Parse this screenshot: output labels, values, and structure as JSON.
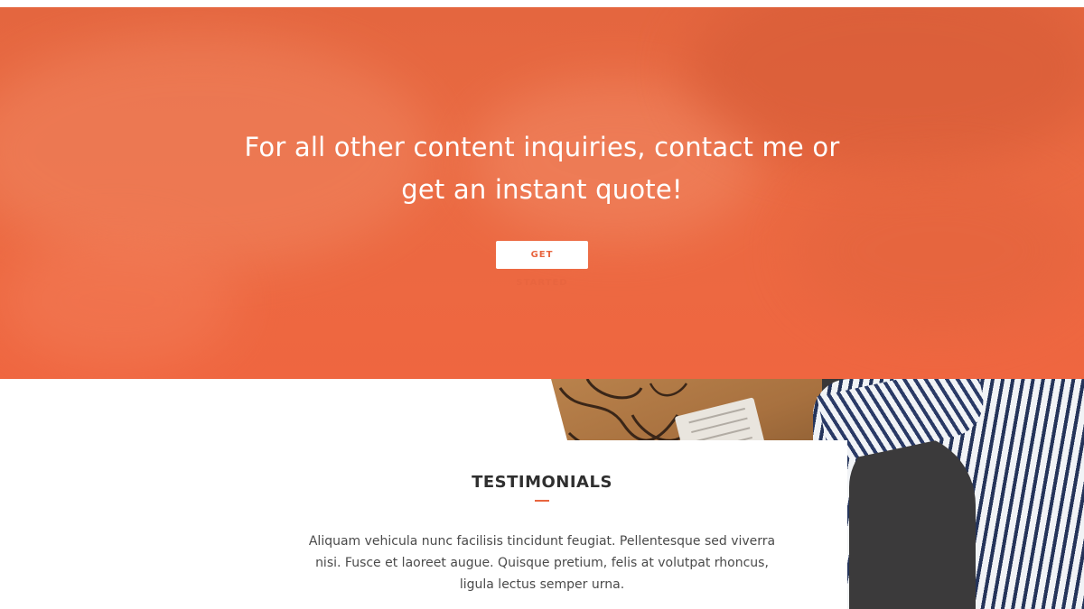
{
  "hero": {
    "heading": "For all other content inquiries, contact me or get an instant quote!",
    "button_label": "GET STARTED",
    "accent_color": "#e8653f"
  },
  "testimonials": {
    "title": "TESTIMONIALS",
    "quote": "Aliquam vehicula nunc facilisis tincidunt feugiat. Pellentesque sed viverra nisi. Fusce et laoreet augue. Quisque pretium, felis at volutpat rhoncus, ligula lectus semper urna."
  }
}
